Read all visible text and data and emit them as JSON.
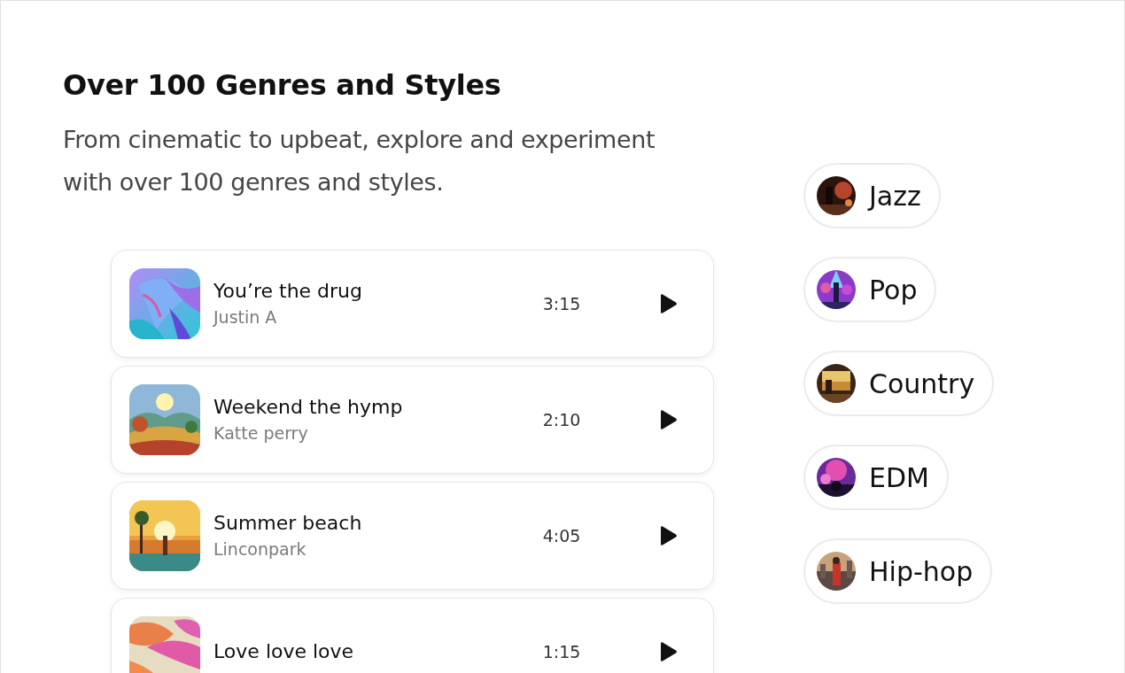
{
  "heading": "Over 100 Genres and Styles",
  "description": "From cinematic to upbeat, explore and experiment with over 100 genres and styles.",
  "tracks": [
    {
      "title": "You’re the drug",
      "artist": "Justin A",
      "duration": "3:15"
    },
    {
      "title": "Weekend the hymp",
      "artist": "Katte perry",
      "duration": "2:10"
    },
    {
      "title": "Summer beach",
      "artist": "Linconpark",
      "duration": "4:05"
    },
    {
      "title": "Love love love",
      "duration": "1:15"
    }
  ],
  "genres": [
    {
      "label": "Jazz"
    },
    {
      "label": "Pop"
    },
    {
      "label": "Country"
    },
    {
      "label": "EDM"
    },
    {
      "label": "Hip-hop"
    }
  ]
}
